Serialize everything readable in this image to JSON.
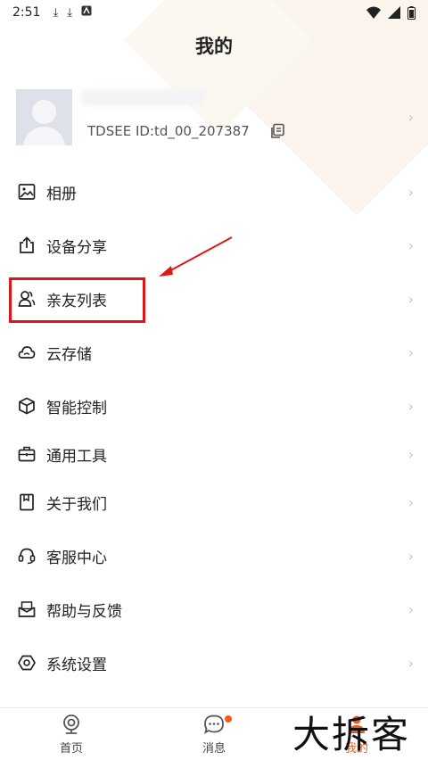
{
  "status_bar": {
    "time": "2:51",
    "icons": [
      "download-icon",
      "download-icon",
      "app-icon"
    ],
    "right_icons": [
      "wifi-icon",
      "signal-icon",
      "battery-icon"
    ]
  },
  "header": {
    "title": "我的"
  },
  "profile": {
    "user_id_text": "TDSEE  ID:td_00_207387",
    "copy_icon": "copy-icon"
  },
  "menu": {
    "items": [
      {
        "label": "相册",
        "icon": "album-icon"
      },
      {
        "label": "设备分享",
        "icon": "share-icon"
      },
      {
        "label": "亲友列表",
        "icon": "friends-icon"
      },
      {
        "label": "云存储",
        "icon": "cloud-icon"
      },
      {
        "label": "智能控制",
        "icon": "cube-icon"
      },
      {
        "label": "通用工具",
        "icon": "toolbox-icon"
      },
      {
        "label": "关于我们",
        "icon": "bookmark-icon"
      },
      {
        "label": "客服中心",
        "icon": "headset-icon"
      },
      {
        "label": "帮助与反馈",
        "icon": "feedback-icon"
      },
      {
        "label": "系统设置",
        "icon": "settings-icon"
      }
    ]
  },
  "annotation": {
    "highlight_color": "#e01515"
  },
  "tabbar": {
    "tabs": [
      {
        "label": "首页",
        "icon": "camera-icon",
        "active": false
      },
      {
        "label": "消息",
        "icon": "message-icon",
        "active": false,
        "has_dot": true
      },
      {
        "label": "我的",
        "icon": "user-icon",
        "active": true
      }
    ],
    "active_color": "#f25a1f"
  },
  "watermark": {
    "text": "大拆客"
  }
}
